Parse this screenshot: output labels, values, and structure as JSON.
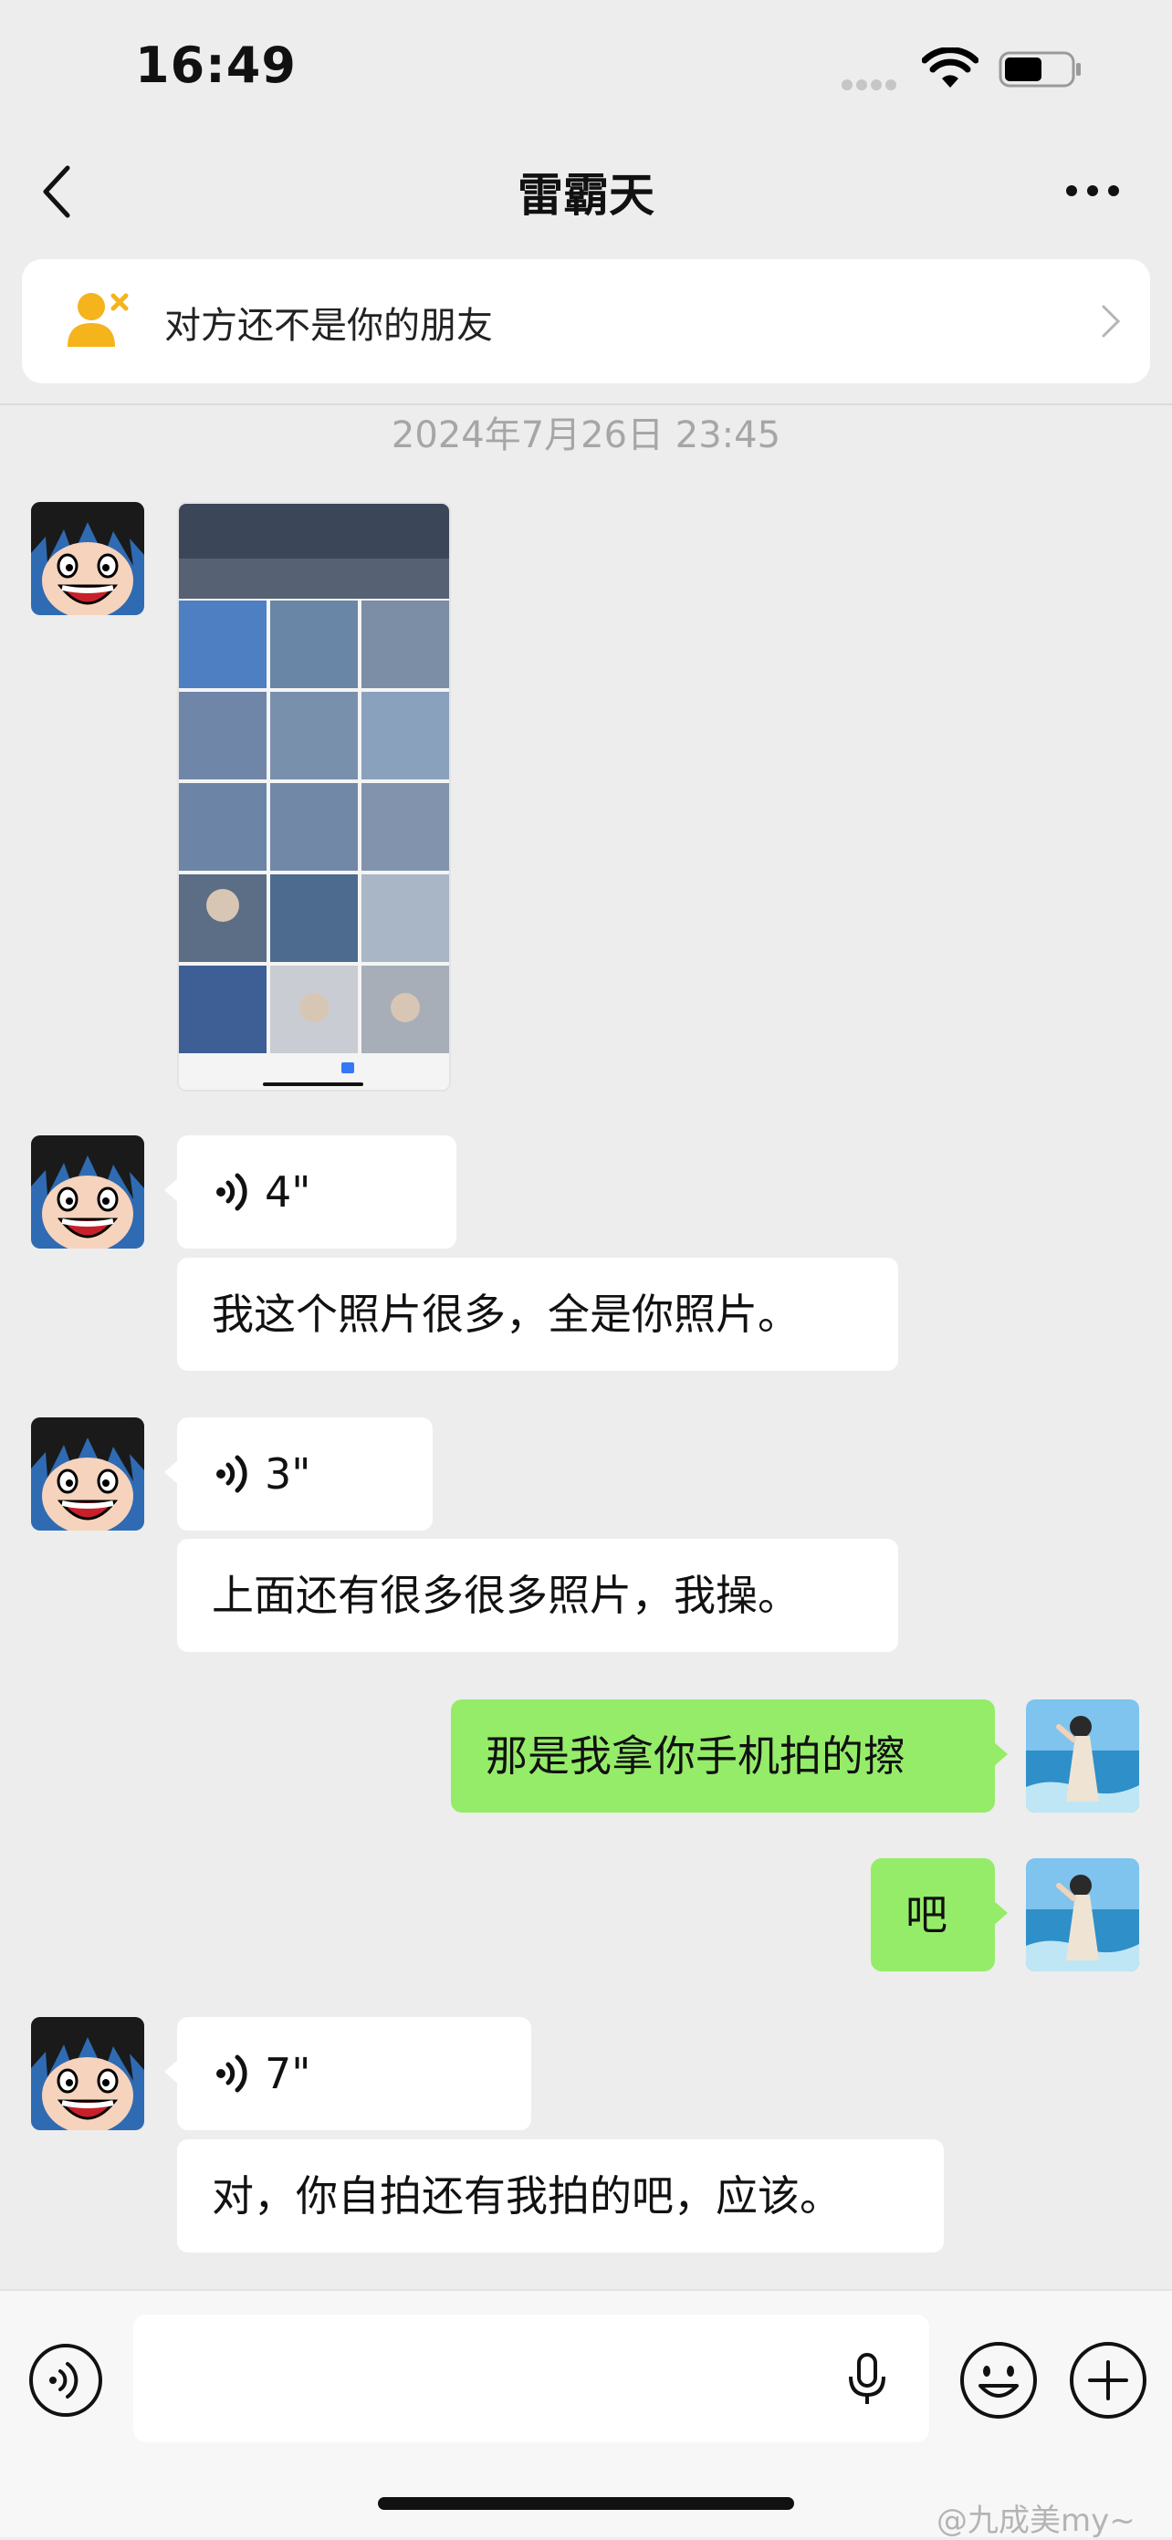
{
  "status_bar": {
    "time": "16:49",
    "wifi_icon": "wifi-icon",
    "battery_icon": "battery-icon"
  },
  "nav": {
    "title": "雷霸天",
    "back_icon": "chevron-left-icon",
    "more_icon": "more-icon"
  },
  "banner": {
    "text": "对方还不是你的朋友",
    "icon": "user-not-friend-icon"
  },
  "timestamp": "2024年7月26日 23:45",
  "messages": [
    {
      "side": "in",
      "type": "image",
      "content": "photo-album-screenshot"
    },
    {
      "side": "in",
      "type": "voice",
      "duration": "4\""
    },
    {
      "side": "in",
      "type": "text",
      "text": "我这个照片很多，全是你照片。"
    },
    {
      "side": "in",
      "type": "voice",
      "duration": "3\""
    },
    {
      "side": "in",
      "type": "text",
      "text": "上面还有很多很多照片，我操。"
    },
    {
      "side": "out",
      "type": "text",
      "text": "那是我拿你手机拍的擦"
    },
    {
      "side": "out",
      "type": "text",
      "text": "吧"
    },
    {
      "side": "in",
      "type": "voice",
      "duration": "7\""
    },
    {
      "side": "in",
      "type": "text",
      "text": "对，你自拍还有我拍的吧，应该。"
    }
  ],
  "colors": {
    "background": "#ededed",
    "incoming_bubble": "#ffffff",
    "outgoing_bubble": "#95ec69",
    "banner_icon": "#f5b31c"
  },
  "input_bar": {
    "voice_icon": "voice-input-icon",
    "mic_icon": "microphone-icon",
    "emoji_icon": "emoji-icon",
    "plus_icon": "plus-icon"
  },
  "watermark": "@九成美my~"
}
